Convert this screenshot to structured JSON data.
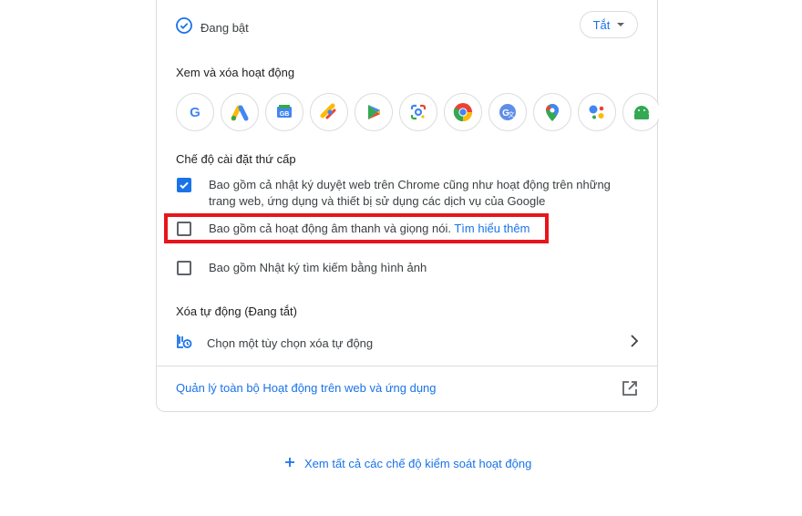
{
  "status": {
    "label": "Đang bật",
    "icon": "check-circle-icon"
  },
  "dropdown": {
    "value": "Tắt"
  },
  "view_delete": {
    "title": "Xem và xóa hoạt động",
    "apps": [
      {
        "name": "google-icon"
      },
      {
        "name": "google-ads-icon"
      },
      {
        "name": "google-news-icon"
      },
      {
        "name": "chrome-webstore-icon"
      },
      {
        "name": "google-play-icon"
      },
      {
        "name": "google-lens-icon"
      },
      {
        "name": "chrome-icon"
      },
      {
        "name": "google-translate-icon"
      },
      {
        "name": "google-maps-icon"
      },
      {
        "name": "google-assistant-icon"
      },
      {
        "name": "android-icon"
      }
    ]
  },
  "sub_settings": {
    "title": "Chế độ cài đặt thứ cấp",
    "options": [
      {
        "text": "Bao gồm cả nhật ký duyệt web trên Chrome cũng như hoạt động trên những trang web, ứng dụng và thiết bị sử dụng các dịch vụ của Google",
        "checked": true
      },
      {
        "text": "Bao gồm cả hoạt động âm thanh và giọng nói.",
        "link": "Tìm hiểu thêm",
        "checked": false
      },
      {
        "text": "Bao gồm Nhật ký tìm kiếm bằng hình ảnh",
        "checked": false
      }
    ]
  },
  "auto_delete": {
    "title": "Xóa tự động (Đang tắt)",
    "option": "Chọn một tùy chọn xóa tự động"
  },
  "manage_link": "Quản lý toàn bộ Hoạt động trên web và ứng dụng",
  "see_all": "Xem tất cả các chế độ kiểm soát hoạt động",
  "colors": {
    "accent": "#1a73e8",
    "highlight": "#e8141c"
  }
}
